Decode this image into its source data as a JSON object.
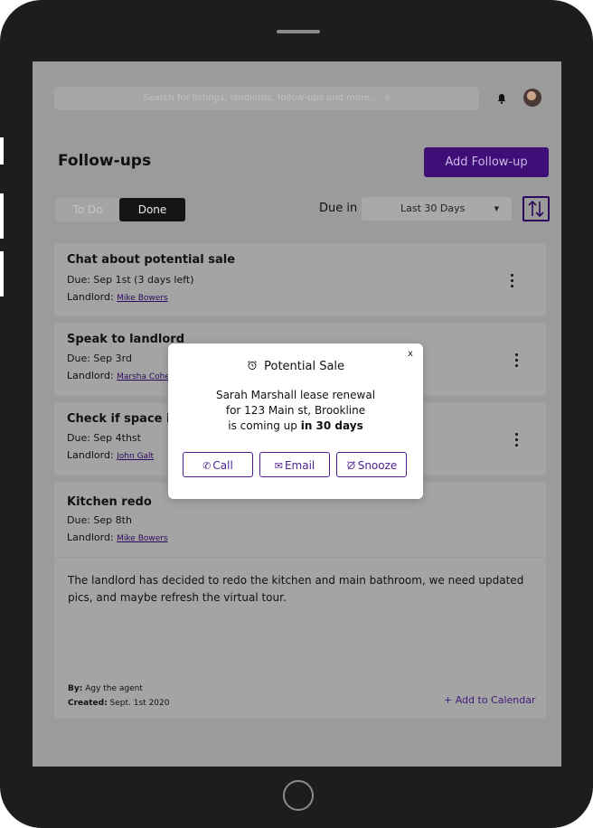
{
  "header": {
    "search_placeholder": "Search for listings, landlords, follow-ups and more...",
    "search_icon": "search-icon",
    "bell_icon": "bell-icon",
    "avatar": "avatar"
  },
  "page": {
    "title": "Follow-ups",
    "add_button": "Add Follow-up"
  },
  "filters": {
    "tab_todo": "To Do",
    "tab_done": "Done",
    "active_tab": "Done",
    "due_label": "Due in",
    "due_value": "Last 30 Days",
    "sort_icon": "sort-arrows-icon"
  },
  "cards": [
    {
      "title": "Chat about potential sale",
      "due": "Due: Sep 1st  (3 days left)",
      "landlord_label": "Landlord:",
      "landlord": "Mike Bowers"
    },
    {
      "title": "Speak to landlord",
      "due": "Due: Sep 3rd",
      "landlord_label": "Landlord:",
      "landlord": "Marsha Cohe"
    },
    {
      "title": "Check if space is",
      "due": "Due: Sep 4thst",
      "landlord_label": "Landlord:",
      "landlord": "John Galt"
    },
    {
      "title": "Kitchen redo",
      "due": "Due: Sep 8th",
      "landlord_label": "Landlord:",
      "landlord": "Mike Bowers",
      "description": "The landlord has decided to redo the kitchen and main bathroom, we need updated pics, and maybe refresh the virtual tour.",
      "by_label": "By:",
      "by": "Agy the agent",
      "created_label": "Created:",
      "created": "Sept. 1st 2020",
      "calendar_link": "+ Add to Calendar"
    }
  ],
  "modal": {
    "close": "x",
    "title_icon": "alarm-icon",
    "title": "Potential Sale",
    "line1": "Sarah Marshall lease renewal",
    "line2": "for 123 Main st, Brookline",
    "line3_prefix": "is coming up ",
    "line3_bold": "in 30 days",
    "call": "Call",
    "email": "Email",
    "snooze": "Snooze"
  },
  "colors": {
    "accent": "#3f0f77",
    "accent_outline": "#4b1f8f",
    "device": "#1d1d1d",
    "overlay_screen": "#9b9b9b"
  }
}
